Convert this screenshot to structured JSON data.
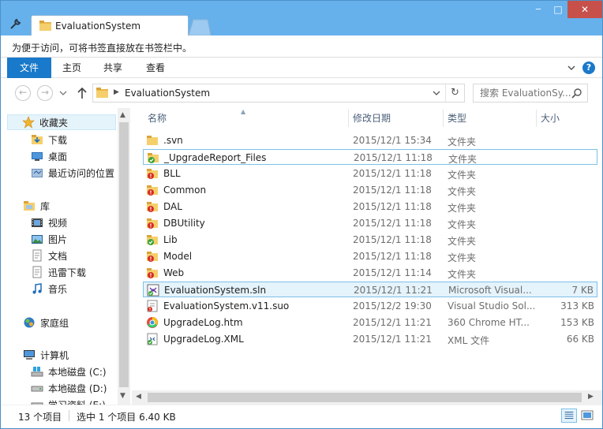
{
  "window": {
    "tab_title": "EvaluationSystem",
    "controls": {
      "minimize": "─",
      "maximize": "□",
      "close": "✕"
    }
  },
  "bookmark_bar": {
    "text": "为便于访问，可将书签直接放在书签栏中。"
  },
  "ribbon": {
    "tabs": [
      "文件",
      "主页",
      "共享",
      "查看"
    ],
    "help": "?"
  },
  "address": {
    "path": "EvaluationSystem",
    "search_placeholder": "搜索 EvaluationSy..."
  },
  "sidebar": {
    "items": [
      {
        "label": "收藏夹",
        "icon": "star-icon"
      },
      {
        "label": "下载",
        "icon": "download-folder-icon"
      },
      {
        "label": "桌面",
        "icon": "desktop-icon"
      },
      {
        "label": "最近访问的位置",
        "icon": "recent-places-icon"
      },
      {
        "label": "库",
        "icon": "library-icon"
      },
      {
        "label": "视频",
        "icon": "video-icon"
      },
      {
        "label": "图片",
        "icon": "pictures-icon"
      },
      {
        "label": "文档",
        "icon": "documents-icon"
      },
      {
        "label": "迅雷下载",
        "icon": "thunder-download-icon"
      },
      {
        "label": "音乐",
        "icon": "music-icon"
      },
      {
        "label": "家庭组",
        "icon": "homegroup-icon"
      },
      {
        "label": "计算机",
        "icon": "computer-icon"
      },
      {
        "label": "本地磁盘 (C:)",
        "icon": "drive-c-icon"
      },
      {
        "label": "本地磁盘 (D:)",
        "icon": "drive-icon"
      },
      {
        "label": "学习资料 (E:)",
        "icon": "drive-icon"
      }
    ]
  },
  "columns": {
    "name": "名称",
    "date": "修改日期",
    "type": "类型",
    "size": "大小"
  },
  "files": [
    {
      "name": ".svn",
      "date": "2015/12/1 15:34",
      "type": "文件夹",
      "size": "",
      "icon": "folder-icon"
    },
    {
      "name": "_UpgradeReport_Files",
      "date": "2015/12/1 11:18",
      "type": "文件夹",
      "size": "",
      "icon": "folder-ok-icon"
    },
    {
      "name": "BLL",
      "date": "2015/12/1 11:18",
      "type": "文件夹",
      "size": "",
      "icon": "folder-modified-icon"
    },
    {
      "name": "Common",
      "date": "2015/12/1 11:18",
      "type": "文件夹",
      "size": "",
      "icon": "folder-modified-icon"
    },
    {
      "name": "DAL",
      "date": "2015/12/1 11:18",
      "type": "文件夹",
      "size": "",
      "icon": "folder-modified-icon"
    },
    {
      "name": "DBUtility",
      "date": "2015/12/1 11:18",
      "type": "文件夹",
      "size": "",
      "icon": "folder-modified-icon"
    },
    {
      "name": "Lib",
      "date": "2015/12/1 11:18",
      "type": "文件夹",
      "size": "",
      "icon": "folder-ok-icon"
    },
    {
      "name": "Model",
      "date": "2015/12/1 11:18",
      "type": "文件夹",
      "size": "",
      "icon": "folder-modified-icon"
    },
    {
      "name": "Web",
      "date": "2015/12/1 11:14",
      "type": "文件夹",
      "size": "",
      "icon": "folder-modified-icon"
    },
    {
      "name": "EvaluationSystem.sln",
      "date": "2015/12/1 11:21",
      "type": "Microsoft Visual...",
      "size": "7 KB",
      "icon": "sln-file-icon"
    },
    {
      "name": "EvaluationSystem.v11.suo",
      "date": "2015/12/2 19:30",
      "type": "Visual Studio Sol...",
      "size": "313 KB",
      "icon": "suo-file-icon"
    },
    {
      "name": "UpgradeLog.htm",
      "date": "2015/12/1 11:21",
      "type": "360 Chrome HT...",
      "size": "153 KB",
      "icon": "html-file-icon"
    },
    {
      "name": "UpgradeLog.XML",
      "date": "2015/12/1 11:21",
      "type": "XML 文件",
      "size": "66 KB",
      "icon": "xml-file-icon"
    }
  ],
  "status": {
    "count": "13 个项目",
    "selection": "选中 1 个项目  6.40 KB"
  },
  "colors": {
    "accent": "#1979ca",
    "frame": "#66b1ec",
    "selection": "#e5f3fb",
    "close": "#c7504b"
  }
}
